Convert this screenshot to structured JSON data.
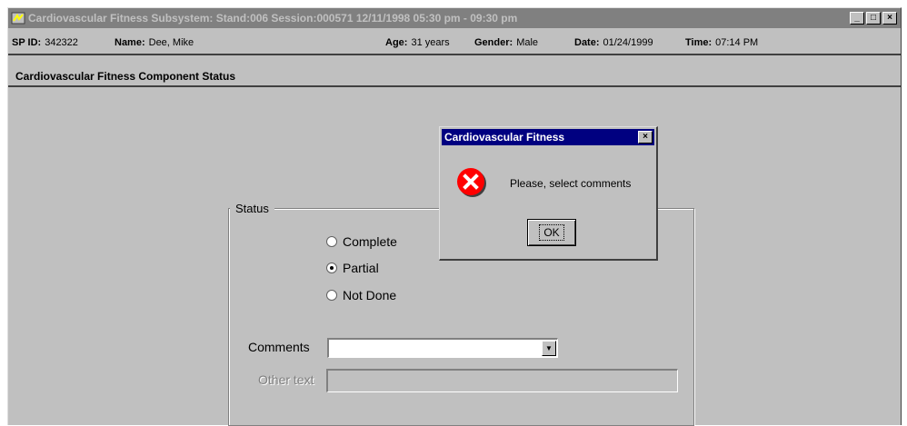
{
  "window": {
    "title": "Cardiovascular Fitness Subsystem: Stand:006 Session:000571 12/11/1998 05:30 pm - 09:30 pm",
    "minimize_label": "_",
    "maximize_label": "□",
    "close_label": "×"
  },
  "info": {
    "sp_id_label": "SP ID:",
    "sp_id_value": "342322",
    "name_label": "Name:",
    "name_value": "Dee, Mike",
    "age_label": "Age:",
    "age_value": "31 years",
    "gender_label": "Gender:",
    "gender_value": "Male",
    "date_label": "Date:",
    "date_value": "01/24/1999",
    "time_label": "Time:",
    "time_value": "07:14 PM"
  },
  "section_title": "Cardiovascular Fitness Component Status",
  "status": {
    "legend": "Status",
    "options": [
      {
        "label": "Complete",
        "checked": false
      },
      {
        "label": "Partial",
        "checked": true
      },
      {
        "label": "Not Done",
        "checked": false
      }
    ]
  },
  "comments": {
    "label": "Comments",
    "value": "",
    "dropdown_glyph": "▼"
  },
  "other": {
    "label": "Other text",
    "value": ""
  },
  "dialog": {
    "title": "Cardiovascular Fitness",
    "close_label": "×",
    "message": "Please, select comments",
    "ok_label": "OK",
    "icon": "error-icon"
  }
}
